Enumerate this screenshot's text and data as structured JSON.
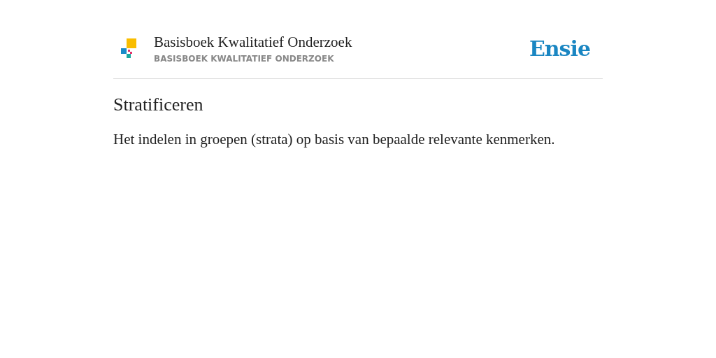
{
  "header": {
    "book_title": "Basisboek Kwalitatief Onderzoek",
    "book_subtitle": "BASISBOEK KWALITATIEF ONDERZOEK",
    "brand": "Ensie"
  },
  "entry": {
    "term": "Stratificeren",
    "definition": "Het indelen in groepen (strata) op basis van bepaalde relevante kenmerken."
  }
}
